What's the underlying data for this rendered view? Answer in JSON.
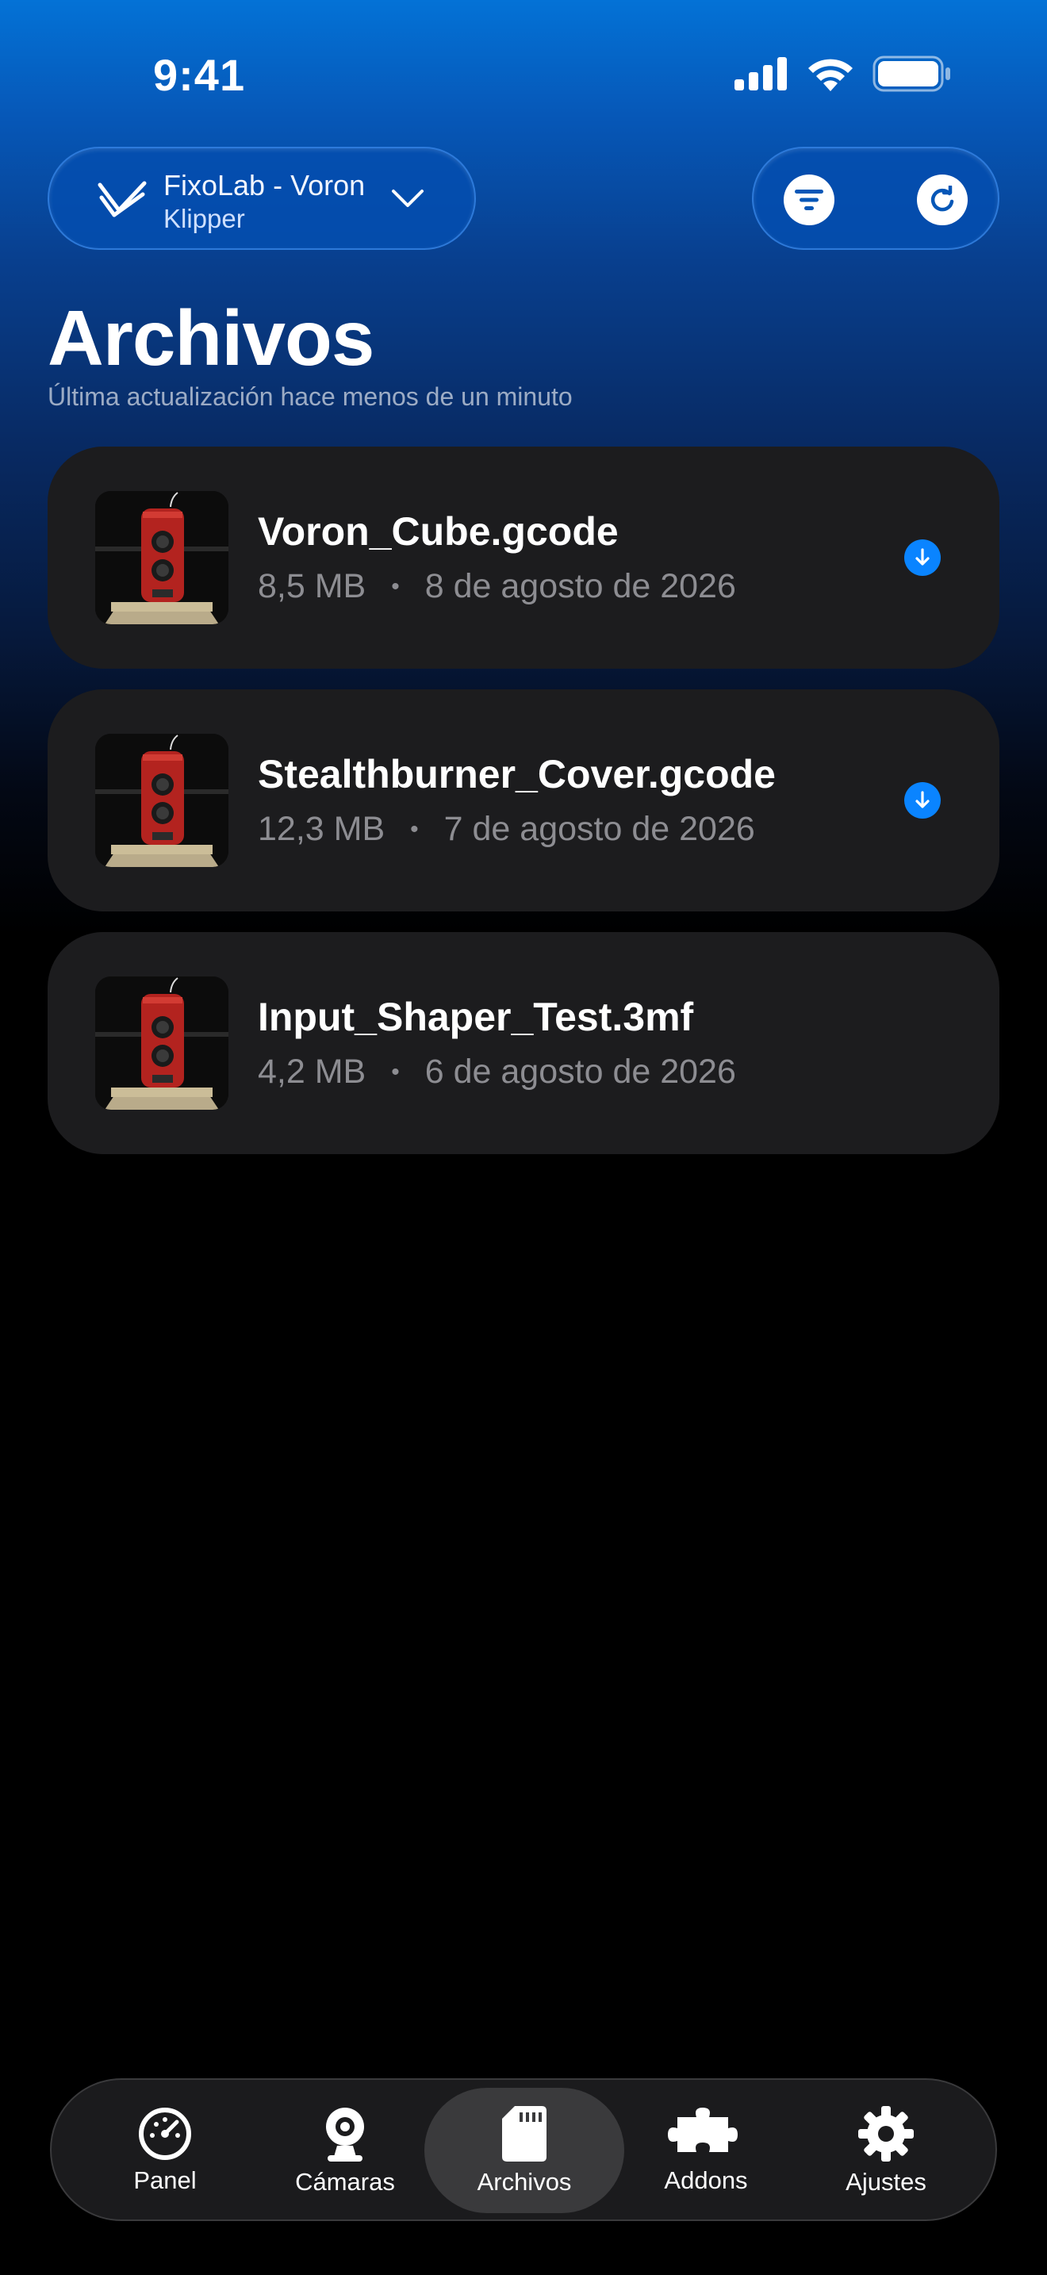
{
  "status_bar": {
    "time": "9:41"
  },
  "header": {
    "printer_name": "FixoLab - Voron",
    "printer_type": "Klipper"
  },
  "page": {
    "title": "Archivos",
    "subtitle": "Última actualización hace menos de un minuto"
  },
  "files": [
    {
      "name": "Voron_Cube.gcode",
      "size": "8,5 MB",
      "date": "8 de agosto de 2026",
      "download": true
    },
    {
      "name": "Stealthburner_Cover.gcode",
      "size": "12,3 MB",
      "date": "7 de agosto de 2026",
      "download": true
    },
    {
      "name": "Input_Shaper_Test.3mf",
      "size": "4,2 MB",
      "date": "6 de agosto de 2026",
      "download": false
    }
  ],
  "meta_separator": "•",
  "tab_bar": {
    "active": "Archivos",
    "tabs": [
      {
        "label": "Panel",
        "icon": "gauge-icon"
      },
      {
        "label": "Cámaras",
        "icon": "webcam-icon"
      },
      {
        "label": "Archivos",
        "icon": "sd-card-icon"
      },
      {
        "label": "Addons",
        "icon": "puzzle-icon"
      },
      {
        "label": "Ajustes",
        "icon": "gear-icon"
      }
    ]
  },
  "colors": {
    "accent": "#0a84ff",
    "card_bg": "#1c1c1e",
    "header_blue": "#0472d6"
  }
}
